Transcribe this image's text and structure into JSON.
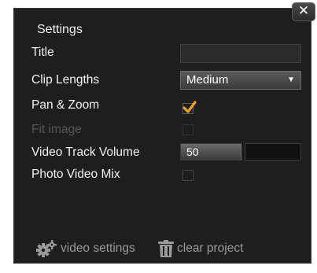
{
  "panel": {
    "title": "Settings",
    "close_glyph": "✕"
  },
  "fields": {
    "title": {
      "label": "Title",
      "value": "",
      "placeholder": ""
    },
    "clip_lengths": {
      "label": "Clip Lengths",
      "value": "Medium",
      "caret": "▼"
    },
    "pan_zoom": {
      "label": "Pan & Zoom",
      "checked": true,
      "check_color": "#f0a020"
    },
    "fit_image": {
      "label": "Fit image",
      "checked": false,
      "disabled": true
    },
    "video_track_volume": {
      "label": "Video Track Volume",
      "value": "50",
      "level_fraction": 0.5
    },
    "photo_video_mix": {
      "label": "Photo Video Mix",
      "checked": false
    }
  },
  "footer": {
    "video_settings": {
      "label": "video settings",
      "icon": "gears-icon"
    },
    "clear_project": {
      "label": "clear project",
      "icon": "trash-icon"
    }
  }
}
